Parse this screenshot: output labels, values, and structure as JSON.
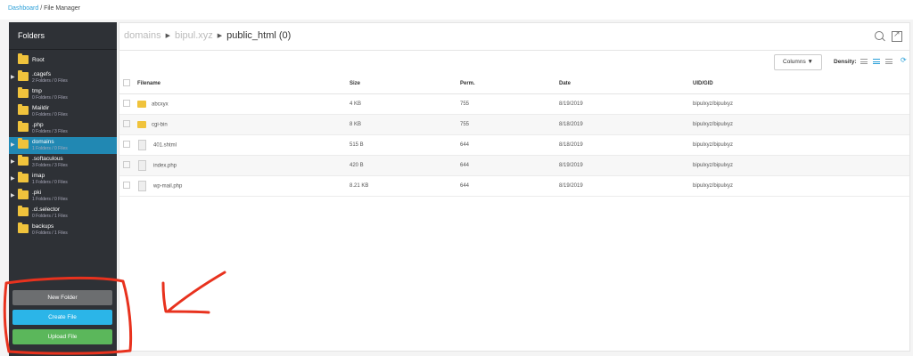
{
  "breadcrumb": {
    "link": "Dashboard",
    "sep": " / ",
    "current": "File Manager"
  },
  "sidebar": {
    "title": "Folders",
    "items": [
      {
        "name": "Root",
        "meta": "",
        "arrow": false,
        "active": false
      },
      {
        "name": ".cagefs",
        "meta": "2 Folders / 0 Files",
        "arrow": true,
        "active": false
      },
      {
        "name": "tmp",
        "meta": "0 Folders / 0 Files",
        "arrow": false,
        "active": false
      },
      {
        "name": "Maildir",
        "meta": "0 Folders / 0 Files",
        "arrow": false,
        "active": false
      },
      {
        "name": ".php",
        "meta": "0 Folders / 3 Files",
        "arrow": false,
        "active": false
      },
      {
        "name": "domains",
        "meta": "1 Folders / 0 Files",
        "arrow": true,
        "active": true
      },
      {
        "name": ".softaculous",
        "meta": "3 Folders / 3 Files",
        "arrow": true,
        "active": false
      },
      {
        "name": "imap",
        "meta": "1 Folders / 0 Files",
        "arrow": true,
        "active": false
      },
      {
        "name": ".pki",
        "meta": "1 Folders / 0 Files",
        "arrow": true,
        "active": false
      },
      {
        "name": ".cl.selector",
        "meta": "0 Folders / 1 Files",
        "arrow": false,
        "active": false
      },
      {
        "name": "backups",
        "meta": "0 Folders / 1 Files",
        "arrow": false,
        "active": false
      }
    ],
    "buttons": {
      "new_folder": "New Folder",
      "create_file": "Create File",
      "upload_file": "Upload File"
    }
  },
  "path": {
    "part1": "domains",
    "part2": "bipul.xyz",
    "current": "public_html",
    "count": "(0)"
  },
  "toolbar": {
    "columns_label": "Columns ▼",
    "density_label": "Density:"
  },
  "table": {
    "headers": {
      "filename": "Filename",
      "size": "Size",
      "perm": "Perm.",
      "date": "Date",
      "uid": "UID/GID"
    },
    "rows": [
      {
        "type": "folder",
        "name": "abcxyx",
        "size": "4 KB",
        "perm": "755",
        "date": "8/19/2019",
        "uid": "bipulxyz/bipulxyz"
      },
      {
        "type": "folder",
        "name": "cgi-bin",
        "size": "8 KB",
        "perm": "755",
        "date": "8/18/2019",
        "uid": "bipulxyz/bipulxyz"
      },
      {
        "type": "file",
        "name": "401.shtml",
        "size": "515 B",
        "perm": "644",
        "date": "8/18/2019",
        "uid": "bipulxyz/bipulxyz"
      },
      {
        "type": "file",
        "name": "index.php",
        "size": "420 B",
        "perm": "644",
        "date": "8/19/2019",
        "uid": "bipulxyz/bipulxyz"
      },
      {
        "type": "file",
        "name": "wp-mail.php",
        "size": "8.21 KB",
        "perm": "644",
        "date": "8/19/2019",
        "uid": "bipulxyz/bipulxyz"
      }
    ]
  },
  "colors": {
    "active": "#2188b3",
    "folder": "#f0c33c",
    "annotation": "#e8321e"
  }
}
